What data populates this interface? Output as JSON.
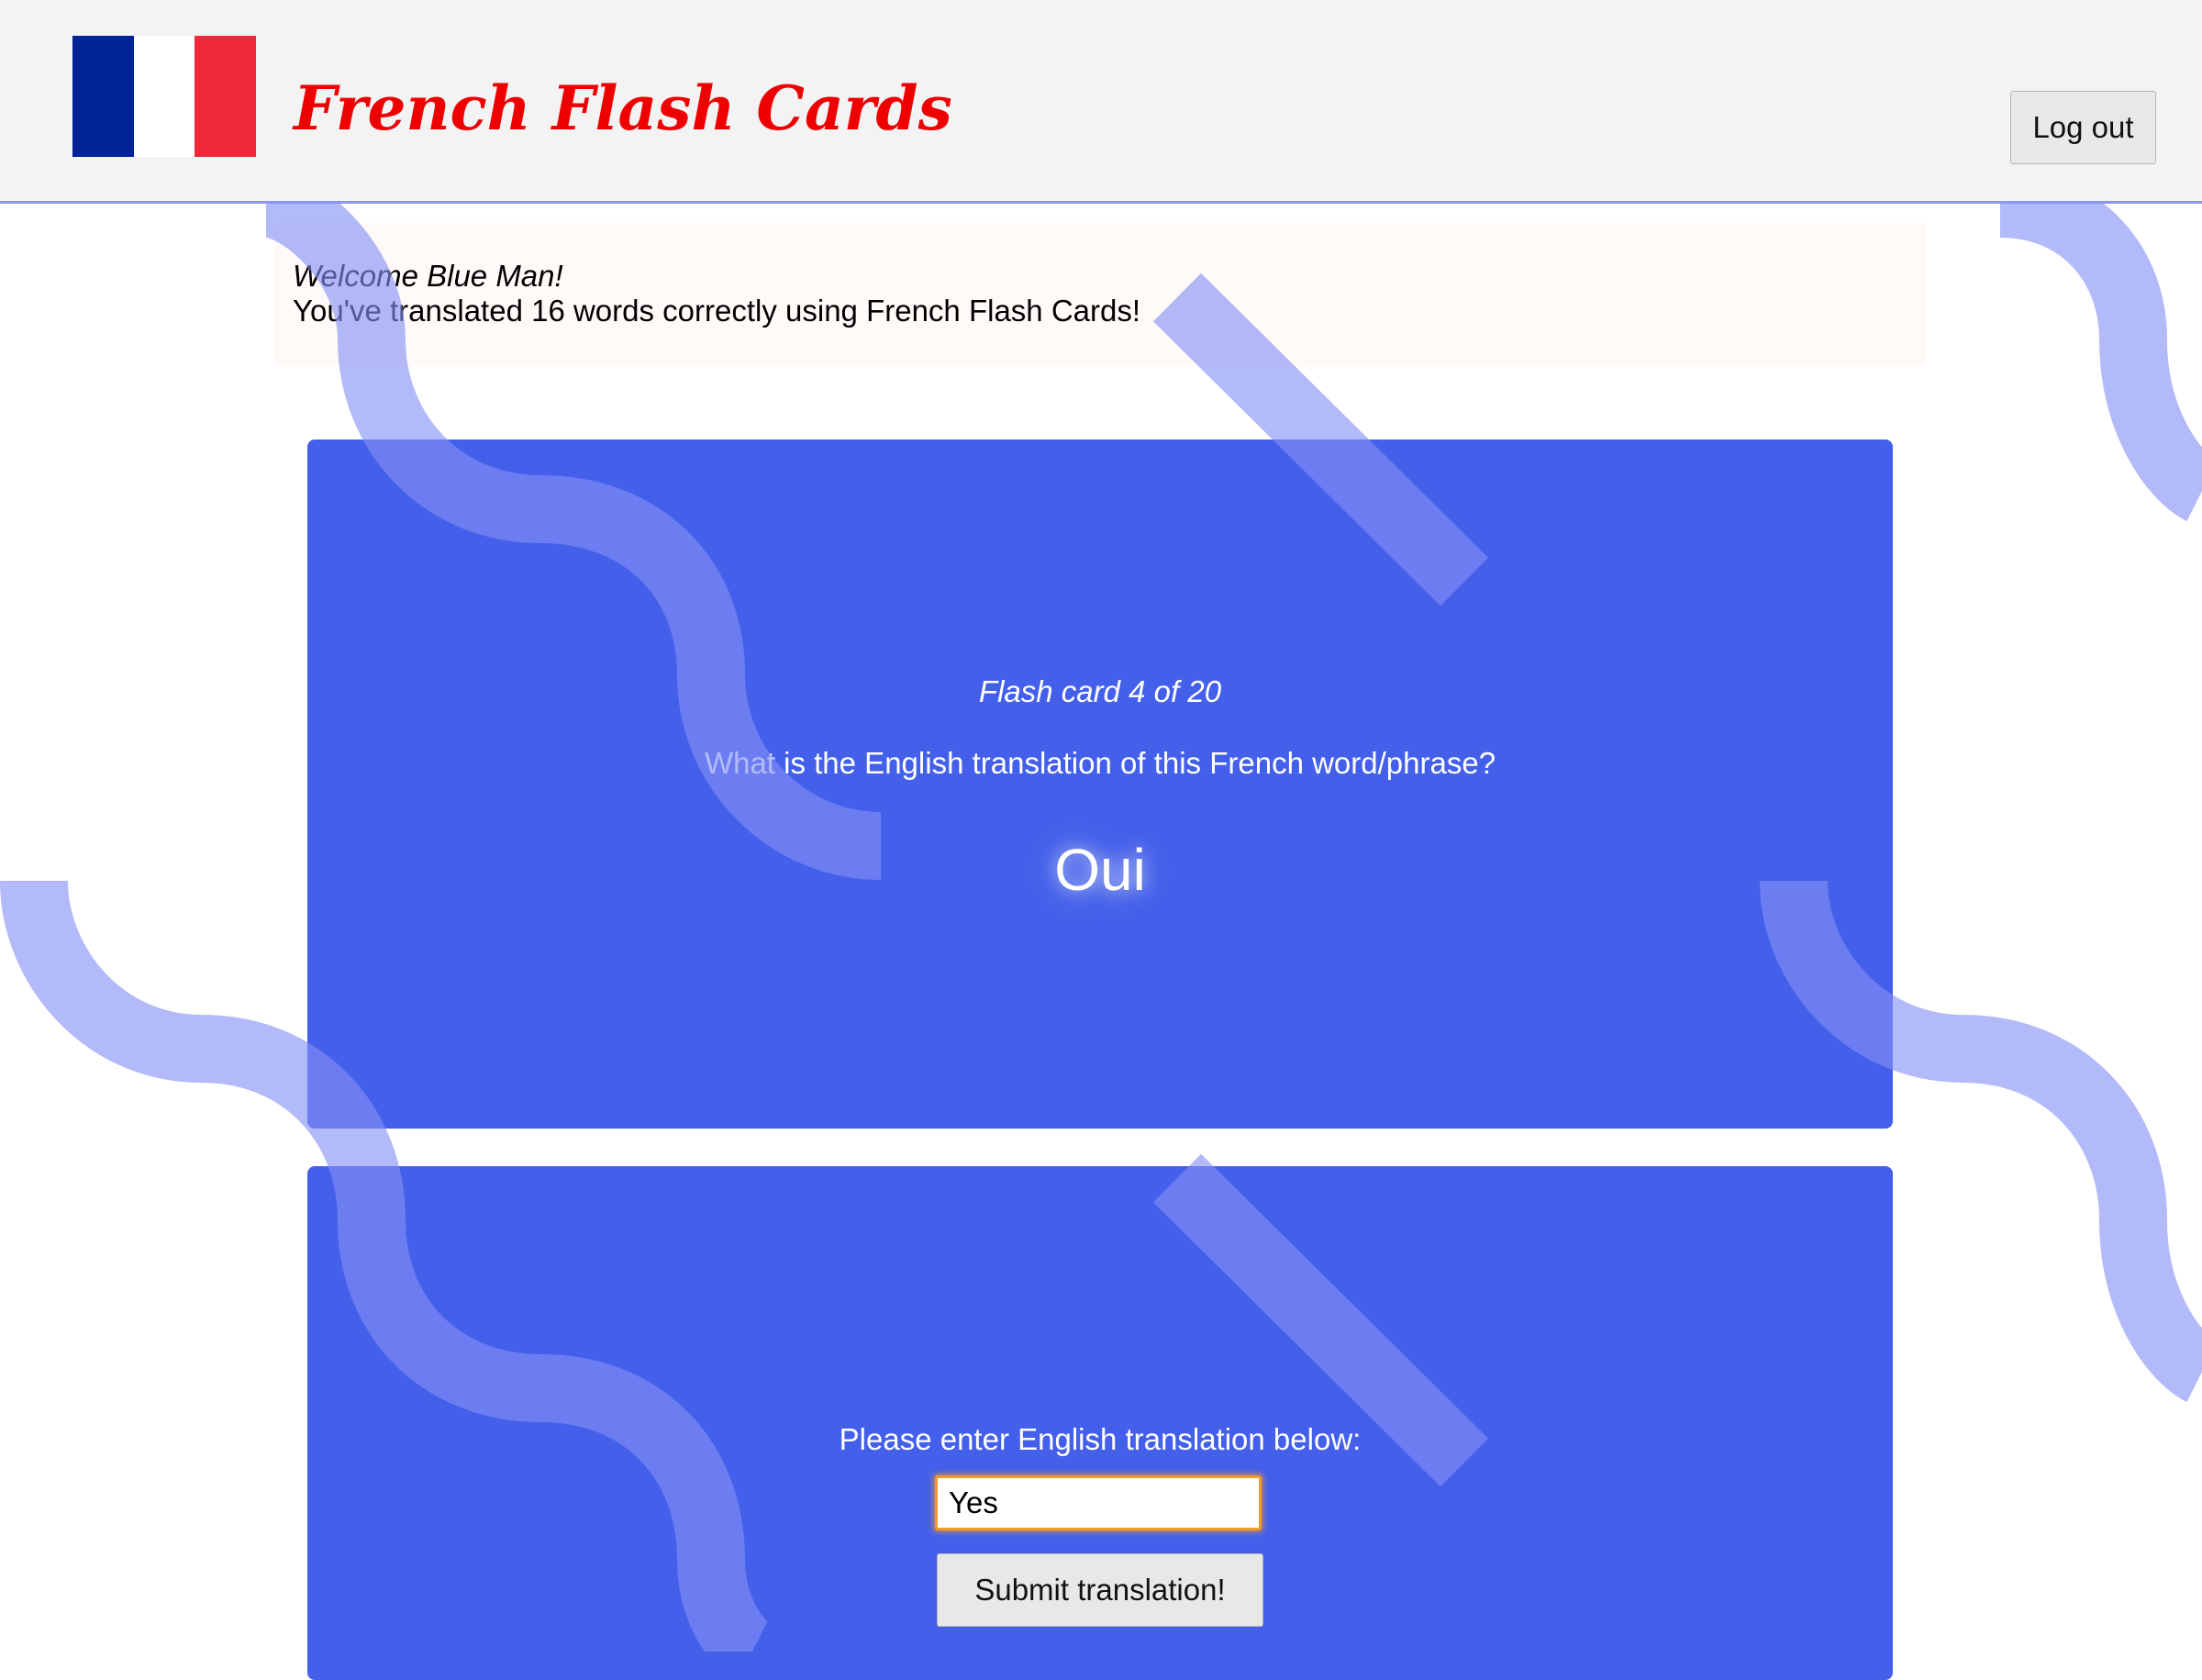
{
  "header": {
    "app_title": "French Flash Cards",
    "logout_label": "Log out",
    "flag_colors": [
      "#002395",
      "#ffffff",
      "#ee2939"
    ]
  },
  "welcome": {
    "greeting": "Welcome Blue Man!",
    "stats": "You've translated 16 words correctly using French Flash Cards!"
  },
  "question_card": {
    "counter": "Flash card 4 of 20",
    "prompt": "What is the English translation of this French word/phrase?",
    "french_word": "Oui"
  },
  "answer_card": {
    "label": "Please enter English translation below:",
    "input_value": "Yes",
    "submit_label": "Submit translation!"
  },
  "colors": {
    "card_background": "#4460ea",
    "title_red": "#ee0000",
    "decor_blue": "#8e9af5",
    "input_focus": "#f29a2a"
  }
}
